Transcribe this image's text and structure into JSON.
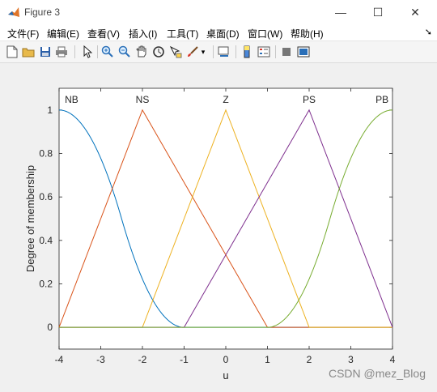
{
  "window": {
    "title": "Figure 3",
    "controls": {
      "minimize": "—",
      "maximize": "☐",
      "close": "✕"
    }
  },
  "menu": {
    "items": [
      "文件(F)",
      "编辑(E)",
      "查看(V)",
      "插入(I)",
      "工具(T)",
      "桌面(D)",
      "窗口(W)",
      "帮助(H)"
    ]
  },
  "toolbar": {
    "icons": [
      "new-figure-icon",
      "open-file-icon",
      "save-icon",
      "print-icon",
      "select-arrow-icon",
      "zoom-in-icon",
      "zoom-out-icon",
      "pan-hand-icon",
      "rotate-3d-icon",
      "data-cursor-icon",
      "brush-icon",
      "brush-dropdown-icon",
      "link-plot-icon",
      "colorbar-icon",
      "legend-icon",
      "hide-plot-tools-icon",
      "show-plot-tools-icon"
    ]
  },
  "chart_data": {
    "type": "line",
    "xlabel": "u",
    "ylabel": "Degree of membership",
    "xlim": [
      -4,
      4
    ],
    "ylim": [
      -0.1,
      1.1
    ],
    "xticks": [
      -4,
      -3,
      -2,
      -1,
      0,
      1,
      2,
      3,
      4
    ],
    "yticks": [
      0,
      0.2,
      0.4,
      0.6,
      0.8,
      1
    ],
    "xtick_labels": [
      "-4",
      "-3",
      "-2",
      "-1",
      "0",
      "1",
      "2",
      "3",
      "4"
    ],
    "ytick_labels": [
      "0",
      "0.2",
      "0.4",
      "0.6",
      "0.8",
      "1"
    ],
    "series": [
      {
        "name": "NB",
        "mf": "zmf",
        "params": [
          -4,
          -1
        ],
        "color": "#0072bd",
        "label_x": -3.7
      },
      {
        "name": "NS",
        "mf": "trimf",
        "params": [
          -4,
          -2,
          1
        ],
        "color": "#d95319",
        "label_x": -2
      },
      {
        "name": "Z",
        "mf": "trimf",
        "params": [
          -2,
          0,
          2
        ],
        "color": "#edb120",
        "label_x": 0
      },
      {
        "name": "PS",
        "mf": "trimf",
        "params": [
          -1,
          2,
          4
        ],
        "color": "#7e2f8e",
        "label_x": 2
      },
      {
        "name": "PB",
        "mf": "smf",
        "params": [
          1,
          4
        ],
        "color": "#77ac30",
        "label_x": 3.75
      }
    ]
  },
  "watermark": "CSDN @mez_Blog"
}
